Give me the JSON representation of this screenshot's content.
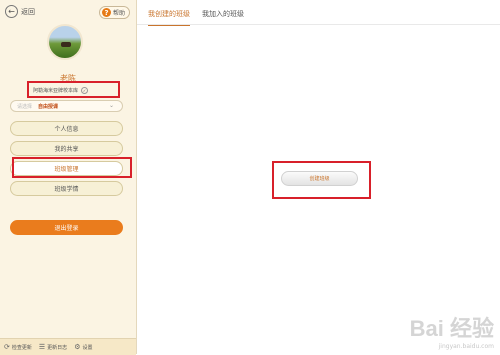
{
  "sidebar": {
    "back_label": "返回",
    "help_label": "帮助",
    "user_name": "老陈",
    "school_label": "阿勒海米亚牌校本库",
    "select": {
      "label": "请选择",
      "value": "自由授课"
    },
    "nav": [
      {
        "label": "个人信息"
      },
      {
        "label": "我的共享"
      },
      {
        "label": "班级管理"
      },
      {
        "label": "班级学情"
      }
    ],
    "logout_label": "退出登录",
    "footer": [
      {
        "label": "检查更新",
        "icon": "refresh-icon"
      },
      {
        "label": "更新日志",
        "icon": "list-icon"
      },
      {
        "label": "设置",
        "icon": "gear-icon"
      }
    ]
  },
  "main": {
    "tabs": [
      {
        "label": "我创建的班级"
      },
      {
        "label": "我加入的班级"
      }
    ],
    "create_button_label": "创建班级"
  },
  "watermark": {
    "logo": "Bai 经验",
    "url": "jingyan.baidu.com"
  },
  "colors": {
    "accent": "#c9742c",
    "logout": "#ea7c1d",
    "highlight": "#d8202a",
    "sidebar_bg": "#fbf4e3"
  }
}
